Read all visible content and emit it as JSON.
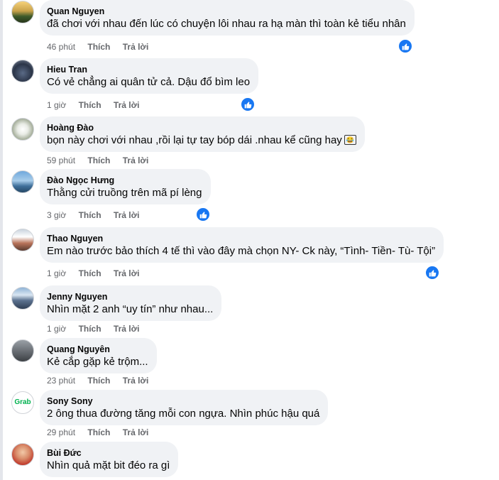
{
  "comments": [
    {
      "author": "Quan Nguyen",
      "text": "đã chơi với nhau đến lúc có chuyện lôi nhau ra hạ màn thì toàn kẻ tiểu nhân",
      "time": "46 phút",
      "like": "Thích",
      "reply": "Trả lời",
      "avatar": "avatar-sunset-field",
      "reaction": "like"
    },
    {
      "author": "Hieu Tran",
      "text": "Có vẻ chẳng ai quân tử cả. Dậu đổ bìm leo",
      "time": "1 giờ",
      "like": "Thích",
      "reply": "Trả lời",
      "avatar": "avatar-motorbike",
      "reaction": "like"
    },
    {
      "author": "Hoàng Đào",
      "text": "bọn này chơi với nhau ,rồi lại tự tay bóp dái .nhau kể cũng hay",
      "emoji": "😂",
      "time": "59 phút",
      "like": "Thích",
      "reply": "Trả lời",
      "avatar": "avatar-white-flower",
      "reaction": ""
    },
    {
      "author": "Đào Ngọc Hưng",
      "text": "Thằng cửi truồng trên mã pí lèng",
      "time": "3 giờ",
      "like": "Thích",
      "reply": "Trả lời",
      "avatar": "avatar-sky-landscape",
      "reaction": "like"
    },
    {
      "author": "Thao Nguyen",
      "text": "Em nào trước bảo thích 4 tế thì vào đây mà chọn NY- Ck này, “Tình- Tiền- Tù- Tội”",
      "time": "1 giờ",
      "like": "Thích",
      "reply": "Trả lời",
      "avatar": "avatar-group-photo",
      "reaction": "like"
    },
    {
      "author": "Jenny Nguyen",
      "text": "Nhìn mặt 2 anh “uy tín” như nhau...",
      "time": "1 giờ",
      "like": "Thích",
      "reply": "Trả lời",
      "avatar": "avatar-mountain",
      "reaction": ""
    },
    {
      "author": "Quang Nguyên",
      "text": "Kẻ cắp gặp kẻ trộm...",
      "time": "23 phút",
      "like": "Thích",
      "reply": "Trả lời",
      "avatar": "avatar-person-grey",
      "reaction": ""
    },
    {
      "author": "Sony Sony",
      "text": "2 ông thua đường tăng mỗi con ngựa. Nhìn phúc hậu quá",
      "time": "29 phút",
      "like": "Thích",
      "reply": "Trả lời",
      "avatar": "avatar-grab-logo",
      "avatar_text": "Grab",
      "reaction": ""
    },
    {
      "author": "Bùi Đức",
      "text": "Nhìn quả mặt bit đéo ra gì",
      "time": "",
      "like": "",
      "reply": "",
      "avatar": "avatar-person-red",
      "reaction": ""
    }
  ],
  "colors": {
    "bubble": "#f0f2f5",
    "meta": "#65676b",
    "like_badge": "#1877f2",
    "grab_green": "#00b14f"
  }
}
